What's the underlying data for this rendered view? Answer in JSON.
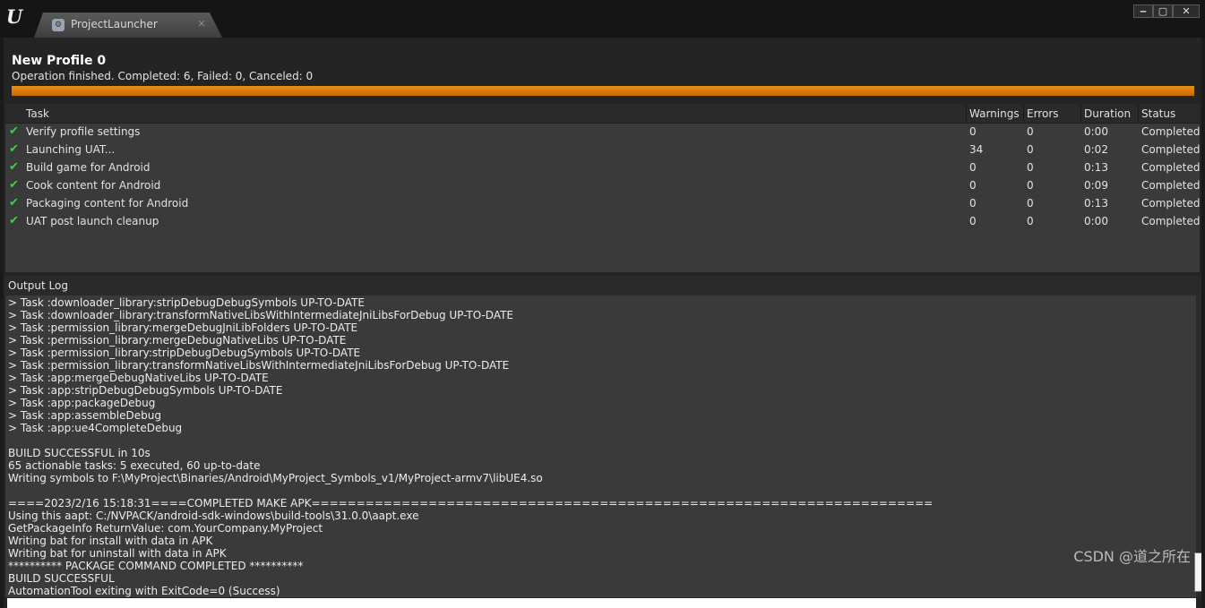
{
  "window": {
    "tab_title": "ProjectLauncher",
    "tab_close": "×",
    "minimize": "‒",
    "maximize": "▢",
    "close": "✕"
  },
  "profile": {
    "title": "New Profile 0",
    "status": "Operation finished. Completed: 6, Failed: 0, Canceled: 0",
    "progress_percent": 100,
    "progress_color": "#e07f10"
  },
  "tasks": {
    "headers": {
      "task": "Task",
      "warnings": "Warnings",
      "errors": "Errors",
      "duration": "Duration",
      "status": "Status"
    },
    "rows": [
      {
        "task": "Verify profile settings",
        "warnings": "0",
        "errors": "0",
        "duration": "0:00",
        "status": "Completed"
      },
      {
        "task": "Launching UAT...",
        "warnings": "34",
        "errors": "0",
        "duration": "0:02",
        "status": "Completed"
      },
      {
        "task": "Build game for Android",
        "warnings": "0",
        "errors": "0",
        "duration": "0:13",
        "status": "Completed"
      },
      {
        "task": "Cook content for Android",
        "warnings": "0",
        "errors": "0",
        "duration": "0:09",
        "status": "Completed"
      },
      {
        "task": "Packaging content for Android",
        "warnings": "0",
        "errors": "0",
        "duration": "0:13",
        "status": "Completed"
      },
      {
        "task": "UAT post launch cleanup",
        "warnings": "0",
        "errors": "0",
        "duration": "0:00",
        "status": "Completed"
      }
    ],
    "check_color": "#3fd23f"
  },
  "output_log": {
    "title": "Output Log",
    "lines": [
      "> Task :downloader_library:stripDebugDebugSymbols UP-TO-DATE",
      "> Task :downloader_library:transformNativeLibsWithIntermediateJniLibsForDebug UP-TO-DATE",
      "> Task :permission_library:mergeDebugJniLibFolders UP-TO-DATE",
      "> Task :permission_library:mergeDebugNativeLibs UP-TO-DATE",
      "> Task :permission_library:stripDebugDebugSymbols UP-TO-DATE",
      "> Task :permission_library:transformNativeLibsWithIntermediateJniLibsForDebug UP-TO-DATE",
      "> Task :app:mergeDebugNativeLibs UP-TO-DATE",
      "> Task :app:stripDebugDebugSymbols UP-TO-DATE",
      "> Task :app:packageDebug",
      "> Task :app:assembleDebug",
      "> Task :app:ue4CompleteDebug",
      "",
      "BUILD SUCCESSFUL in 10s",
      "65 actionable tasks: 5 executed, 60 up-to-date",
      "Writing symbols to F:\\MyProject\\Binaries/Android\\MyProject_Symbols_v1/MyProject-armv7\\libUE4.so",
      "",
      "====2023/2/16 15:18:31====COMPLETED MAKE APK=====================================================================",
      "Using this aapt: C:/NVPACK/android-sdk-windows\\build-tools\\31.0.0\\aapt.exe",
      "GetPackageInfo ReturnValue: com.YourCompany.MyProject",
      "Writing bat for install with data in APK",
      "Writing bat for uninstall with data in APK",
      "********** PACKAGE COMMAND COMPLETED **********",
      "BUILD SUCCESSFUL",
      "AutomationTool exiting with ExitCode=0 (Success)"
    ]
  },
  "watermark": "CSDN @道之所在"
}
